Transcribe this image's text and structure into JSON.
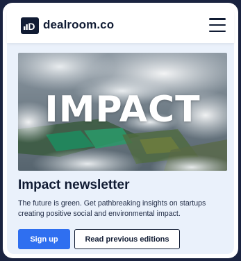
{
  "header": {
    "logo_mark": "D",
    "brand": "dealroom.co",
    "menu_icon": "hamburger-menu-icon"
  },
  "hero": {
    "overlay_text": "IMPACT"
  },
  "newsletter": {
    "title": "Impact newsletter",
    "description": "The future is green. Get pathbreaking insights on startups creating positive social and environmental impact.",
    "signup_label": "Sign up",
    "previous_label": "Read previous editions"
  },
  "colors": {
    "brand_dark": "#101b33",
    "primary": "#2f6ff0",
    "panel_bg": "#eaf1fb",
    "outer_bg": "#1a2340"
  }
}
